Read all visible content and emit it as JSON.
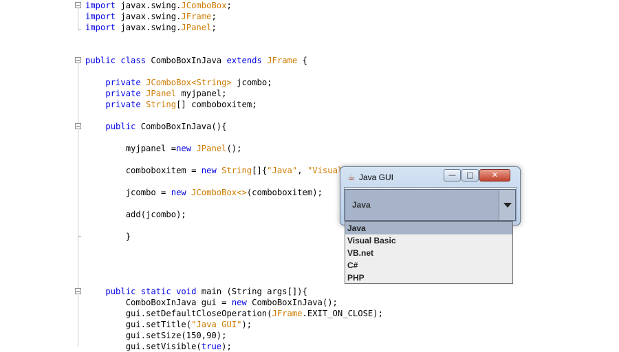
{
  "editor": {
    "lines": [
      {
        "id": "l1",
        "segs": [
          {
            "t": "import",
            "c": "kw"
          },
          {
            "t": " javax.swing."
          },
          {
            "t": "JComboBox",
            "c": "str"
          },
          {
            "t": ";"
          }
        ]
      },
      {
        "id": "l2",
        "segs": [
          {
            "t": "import",
            "c": "kw"
          },
          {
            "t": " javax.swing."
          },
          {
            "t": "JFrame",
            "c": "str"
          },
          {
            "t": ";"
          }
        ]
      },
      {
        "id": "l3",
        "segs": [
          {
            "t": "import",
            "c": "kw"
          },
          {
            "t": " javax.swing."
          },
          {
            "t": "JPanel",
            "c": "str"
          },
          {
            "t": ";"
          }
        ]
      },
      {
        "id": "l4",
        "segs": [
          {
            "t": "public class",
            "c": "kw"
          },
          {
            "t": " ComboBoxInJava "
          },
          {
            "t": "extends",
            "c": "kw"
          },
          {
            "t": " "
          },
          {
            "t": "JFrame",
            "c": "str"
          },
          {
            "t": " {"
          }
        ]
      },
      {
        "id": "l5",
        "segs": [
          {
            "t": "    private",
            "c": "kw"
          },
          {
            "t": " "
          },
          {
            "t": "JComboBox",
            "c": "str"
          },
          {
            "t": "<",
            "c": "str"
          },
          {
            "t": "String",
            "c": "str"
          },
          {
            "t": ">",
            "c": "str"
          },
          {
            "t": " jcombo;"
          }
        ]
      },
      {
        "id": "l6",
        "segs": [
          {
            "t": "    private",
            "c": "kw"
          },
          {
            "t": " "
          },
          {
            "t": "JPanel",
            "c": "str"
          },
          {
            "t": " myjpanel;"
          }
        ]
      },
      {
        "id": "l7",
        "segs": [
          {
            "t": "    private",
            "c": "kw"
          },
          {
            "t": " "
          },
          {
            "t": "String",
            "c": "str"
          },
          {
            "t": "[] comboboxitem;"
          }
        ]
      },
      {
        "id": "l8",
        "segs": [
          {
            "t": "    public",
            "c": "kw"
          },
          {
            "t": " ComboBoxInJava(){"
          }
        ]
      },
      {
        "id": "l9",
        "segs": [
          {
            "t": "        myjpanel ="
          },
          {
            "t": "new",
            "c": "kw"
          },
          {
            "t": " "
          },
          {
            "t": "JPanel",
            "c": "str"
          },
          {
            "t": "();"
          }
        ]
      },
      {
        "id": "l10",
        "segs": [
          {
            "t": "        comboboxitem = "
          },
          {
            "t": "new",
            "c": "kw"
          },
          {
            "t": " "
          },
          {
            "t": "String",
            "c": "str"
          },
          {
            "t": "[]{"
          },
          {
            "t": "\"Java\"",
            "c": "str"
          },
          {
            "t": ", "
          },
          {
            "t": "\"Visual Basic\"",
            "c": "str"
          },
          {
            "t": ", "
          },
          {
            "t": "\"VB.net\"",
            "c": "str"
          },
          {
            "t": ", "
          },
          {
            "t": "\"C#\"",
            "c": "str"
          },
          {
            "t": ", "
          },
          {
            "t": "\"PHP\"",
            "c": "str"
          },
          {
            "t": "};"
          }
        ]
      },
      {
        "id": "l11",
        "segs": [
          {
            "t": "        jcombo = "
          },
          {
            "t": "new",
            "c": "kw"
          },
          {
            "t": " "
          },
          {
            "t": "JComboBox",
            "c": "str"
          },
          {
            "t": "<>",
            "c": "str"
          },
          {
            "t": "(comboboxitem);"
          }
        ]
      },
      {
        "id": "l12",
        "segs": [
          {
            "t": "        add(jcombo);"
          }
        ]
      },
      {
        "id": "l13",
        "segs": [
          {
            "t": "        }"
          }
        ]
      },
      {
        "id": "l14",
        "segs": [
          {
            "t": "    public static void",
            "c": "kw"
          },
          {
            "t": " main (String args[]){"
          }
        ]
      },
      {
        "id": "l15",
        "segs": [
          {
            "t": "        ComboBoxInJava gui = "
          },
          {
            "t": "new",
            "c": "kw"
          },
          {
            "t": " ComboBoxInJava();"
          }
        ]
      },
      {
        "id": "l16",
        "segs": [
          {
            "t": "        gui.setDefaultCloseOperation("
          },
          {
            "t": "JFrame",
            "c": "str"
          },
          {
            "t": ".EXIT_ON_CLOSE);"
          }
        ]
      },
      {
        "id": "l17",
        "segs": [
          {
            "t": "        gui.setTitle("
          },
          {
            "t": "\"Java GUI\"",
            "c": "str"
          },
          {
            "t": ");"
          }
        ]
      },
      {
        "id": "l18",
        "segs": [
          {
            "t": "        gui.setSize(150,90);"
          }
        ]
      },
      {
        "id": "l19",
        "segs": [
          {
            "t": "        gui.setVisible("
          },
          {
            "t": "true",
            "c": "kw"
          },
          {
            "t": ");"
          }
        ]
      }
    ]
  },
  "window": {
    "title": "Java GUI",
    "icon": "java-cup-icon",
    "minimize_glyph": "—",
    "maximize_glyph": "□",
    "close_glyph": "✕",
    "combo": {
      "selected": "Java",
      "options": [
        "Java",
        "Visual Basic",
        "VB.net",
        "C#",
        "PHP"
      ],
      "selected_index": 0
    }
  },
  "colors": {
    "keyword": "#0000e6",
    "type": "#ce7b00",
    "selection": "#a6b3c8"
  }
}
